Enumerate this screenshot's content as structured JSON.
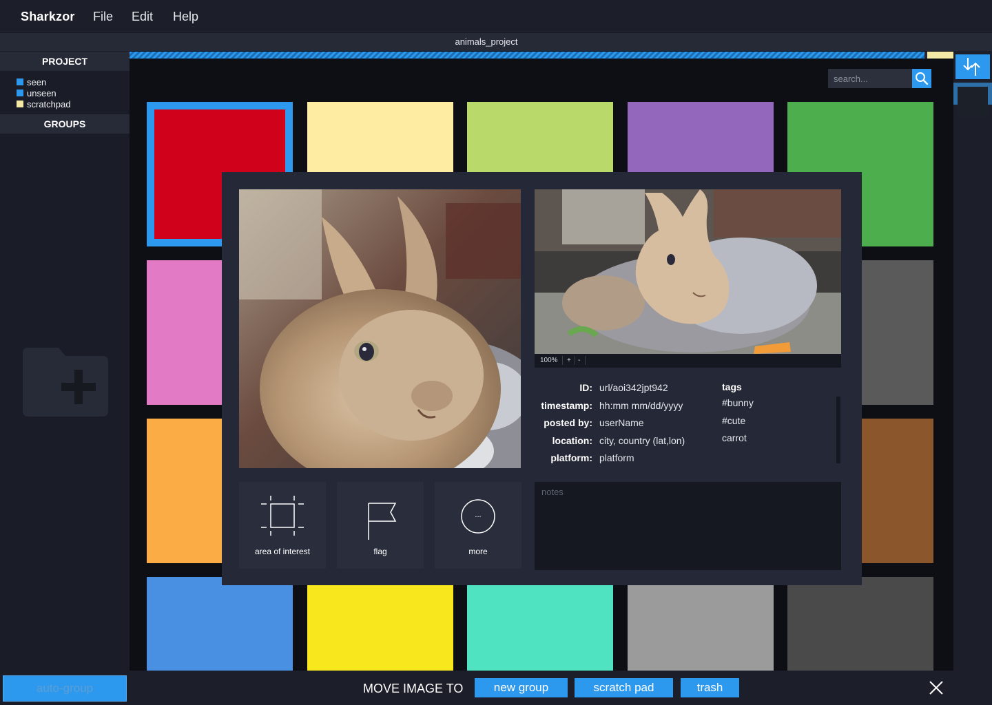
{
  "app": {
    "name": "Sharkzor",
    "menu": [
      "File",
      "Edit",
      "Help"
    ]
  },
  "project": {
    "title": "animals_project",
    "progress_fraction": 0.965
  },
  "sidebar": {
    "project_header": "PROJECT",
    "legend": [
      {
        "label": "seen",
        "color": "#2d99ee"
      },
      {
        "label": "unseen",
        "color": "#2d99ee"
      },
      {
        "label": "scratchpad",
        "color": "#f4e9a6"
      }
    ],
    "groups_header": "GROUPS",
    "add_group_icon": "folder-add-icon",
    "auto_group_label": "auto-group"
  },
  "search": {
    "placeholder": "search...",
    "icon": "search-icon"
  },
  "grid": {
    "tiles": [
      {
        "color": "#d0021b",
        "selected": true
      },
      {
        "color": "#fdeca2"
      },
      {
        "color": "#b9d96b"
      },
      {
        "color": "#9367bb"
      },
      {
        "color": "#4cae4c"
      },
      {
        "color": "#e27ac5"
      },
      {
        "color": "#3a3c3f"
      },
      {
        "color": "#3a3c3f"
      },
      {
        "color": "#3a3c3f"
      },
      {
        "color": "#5a5a5a"
      },
      {
        "color": "#fbac45"
      },
      {
        "color": "#3a3c3f"
      },
      {
        "color": "#3a3c3f"
      },
      {
        "color": "#3a3c3f"
      },
      {
        "color": "#8c562d"
      },
      {
        "color": "#4a90e2"
      },
      {
        "color": "#f8e71c"
      },
      {
        "color": "#50e3c2"
      },
      {
        "color": "#9b9b9b"
      },
      {
        "color": "#4a4a4a"
      }
    ]
  },
  "detail": {
    "zoom": {
      "level": "100%",
      "plus": "+",
      "minus": "-"
    },
    "fields": [
      {
        "key": "ID:",
        "value": "url/aoi342jpt942"
      },
      {
        "key": "timestamp:",
        "value": "hh:mm mm/dd/yyyy"
      },
      {
        "key": "posted by:",
        "value": "userName"
      },
      {
        "key": "location:",
        "value": "city, country (lat,lon)"
      },
      {
        "key": "platform:",
        "value": "platform"
      }
    ],
    "tags_title": "tags",
    "tags": [
      "#bunny",
      "#cute",
      "carrot"
    ],
    "actions": [
      {
        "label": "area of interest",
        "icon": "area-of-interest-icon"
      },
      {
        "label": "flag",
        "icon": "flag-icon"
      },
      {
        "label": "more",
        "icon": "more-icon",
        "glyph": "..."
      }
    ],
    "notes_placeholder": "notes"
  },
  "bottom_bar": {
    "label": "MOVE IMAGE TO",
    "buttons": [
      "new group",
      "scratch pad",
      "trash"
    ],
    "close_icon": "close-icon"
  },
  "right_rail": {
    "sort_icon": "sort-arrows-icon"
  },
  "colors": {
    "accent": "#2d99ee",
    "background": "#10131a",
    "panel": "#252937",
    "scratchpad": "#f4e9a6"
  }
}
